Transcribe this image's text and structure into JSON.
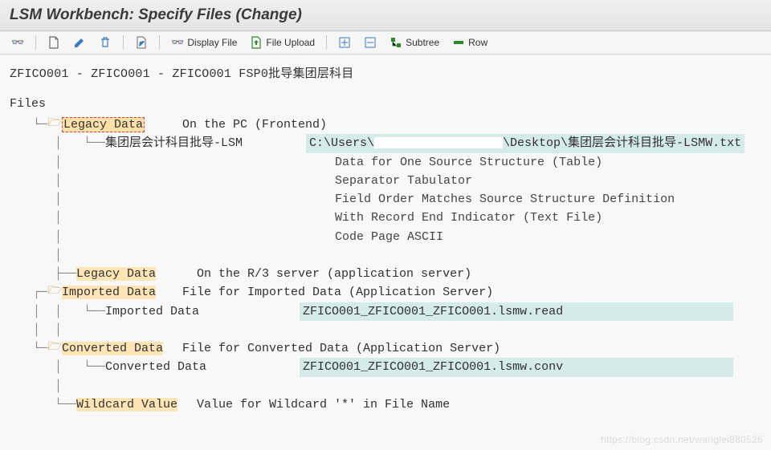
{
  "title": "LSM Workbench: Specify Files (Change)",
  "toolbar": {
    "display_file": "Display File",
    "file_upload": "File Upload",
    "subtree": "Subtree",
    "row": "Row"
  },
  "breadcrumb": "ZFICO001 - ZFICO001 - ZFICO001 FSP0批导集团层科目",
  "files_label": "Files",
  "tree": {
    "legacy_pc": {
      "label": "Legacy Data",
      "desc": "On the PC (Frontend)",
      "file_label": "集团层会计科目批导-LSM",
      "file_path_left": "C:\\Users\\",
      "file_path_right": "\\Desktop\\集团层会计科目批导-LSMW.txt",
      "attrs": [
        "Data for One Source Structure (Table)",
        "Separator Tabulator",
        "Field Order Matches Source Structure Definition",
        "With Record End Indicator (Text File)",
        "Code Page ASCII"
      ]
    },
    "legacy_r3": {
      "label": "Legacy Data",
      "desc": "On the R/3 server (application server)"
    },
    "imported": {
      "label": "Imported Data",
      "desc": "File for Imported Data (Application Server)",
      "child_label": "Imported Data",
      "child_path": "ZFICO001_ZFICO001_ZFICO001.lsmw.read"
    },
    "converted": {
      "label": "Converted Data",
      "desc": "File for Converted Data (Application Server)",
      "child_label": "Converted Data",
      "child_path": "ZFICO001_ZFICO001_ZFICO001.lsmw.conv"
    },
    "wildcard": {
      "label": "Wildcard Value",
      "desc": "Value for Wildcard '*' in File Name"
    }
  },
  "watermark": "https://blog.csdn.net/wanglei880526"
}
